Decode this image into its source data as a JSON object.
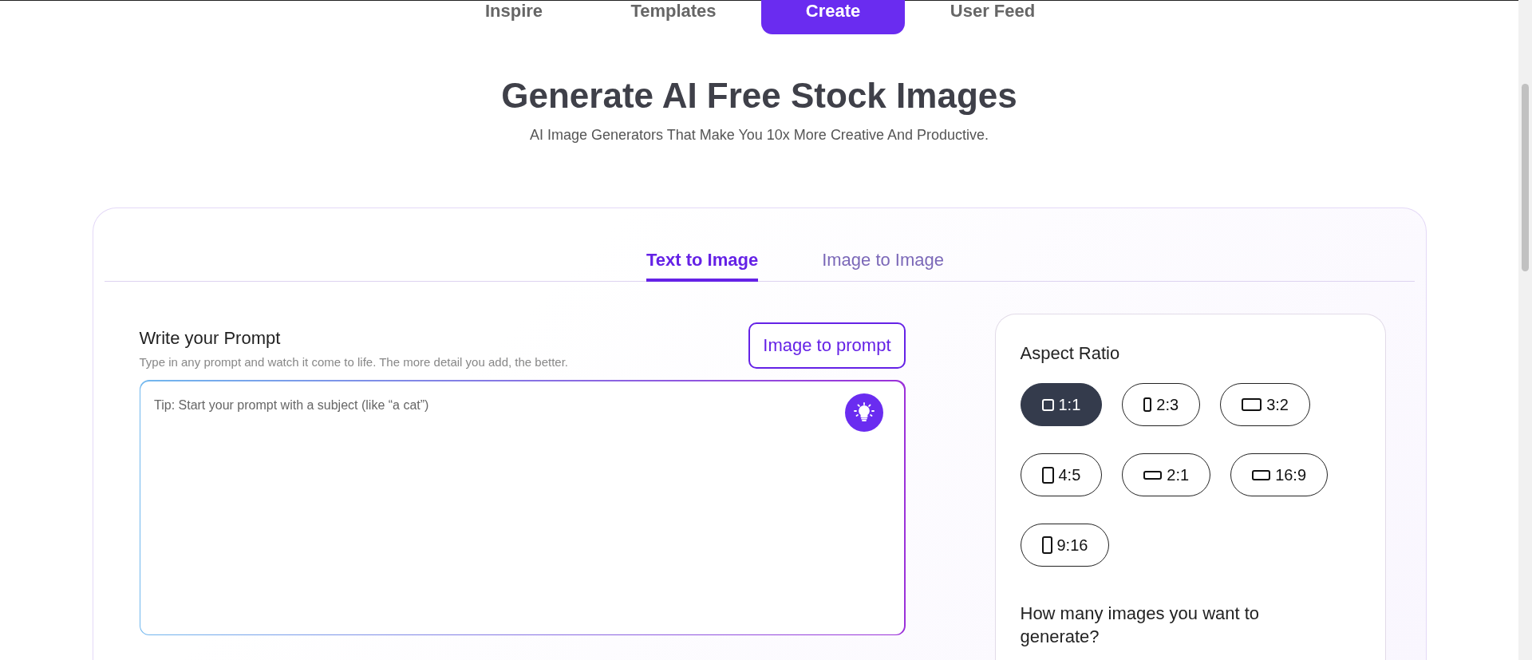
{
  "nav": [
    {
      "label": "Inspire",
      "selected": false
    },
    {
      "label": "Templates",
      "selected": false
    },
    {
      "label": "Create",
      "selected": true
    },
    {
      "label": "User Feed",
      "selected": false
    }
  ],
  "heading": "Generate AI Free Stock Images",
  "subheading": "AI Image Generators That Make You 10x More Creative And Productive.",
  "mode_tabs": [
    {
      "label": "Text to Image",
      "selected": true
    },
    {
      "label": "Image to Image",
      "selected": false
    }
  ],
  "prompt": {
    "label": "Write your Prompt",
    "hint": "Type in any prompt and watch it come to life. The more detail you add, the better.",
    "button": "Image to prompt",
    "placeholder": "Tip: Start your prompt with a subject (like “a cat”)"
  },
  "aspect": {
    "title": "Aspect Ratio",
    "options": [
      {
        "label": "1:1",
        "selected": true
      },
      {
        "label": "2:3",
        "selected": false
      },
      {
        "label": "3:2",
        "selected": false
      },
      {
        "label": "4:5",
        "selected": false
      },
      {
        "label": "2:1",
        "selected": false
      },
      {
        "label": "16:9",
        "selected": false
      },
      {
        "label": "9:16",
        "selected": false
      }
    ],
    "count_question": "How many images you want to generate?"
  }
}
